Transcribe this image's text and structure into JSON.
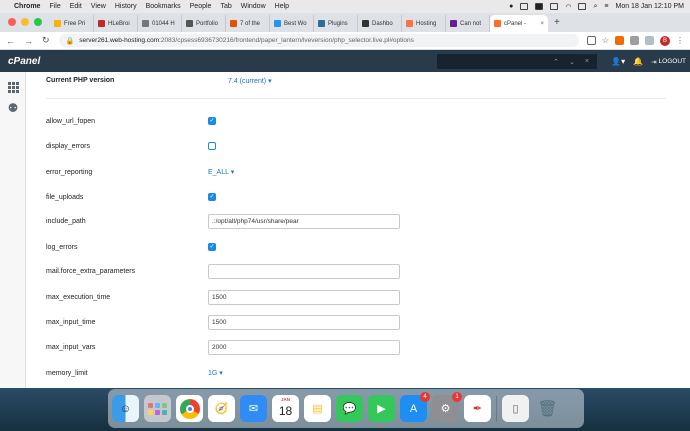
{
  "menubar": {
    "items": [
      "Chrome",
      "File",
      "Edit",
      "View",
      "History",
      "Bookmarks",
      "People",
      "Tab",
      "Window",
      "Help"
    ],
    "clock": "Mon 18 Jan  12:10 PM"
  },
  "tabs": [
    {
      "label": "Free Pri",
      "color": "#f4b400"
    },
    {
      "label": "HLeBroi",
      "color": "#c62828"
    },
    {
      "label": "01044 H",
      "color": "#777777"
    },
    {
      "label": "Portfolio",
      "color": "#555555"
    },
    {
      "label": "7 of the",
      "color": "#e65100"
    },
    {
      "label": "Best Wo",
      "color": "#2196f3"
    },
    {
      "label": "Plugins",
      "color": "#2a6f97"
    },
    {
      "label": "Dashbo",
      "color": "#333333"
    },
    {
      "label": "Hosting",
      "color": "#ff7043"
    },
    {
      "label": "Can not",
      "color": "#6a1b9a"
    },
    {
      "label": "cPanel -",
      "color": "#ff6c2c",
      "active": true
    }
  ],
  "address": {
    "host": "server261.web-hosting.com",
    "path": ":2083/cpsess6936730216/frontend/paper_lantern/lveversion/php_selector.live.pl#options"
  },
  "header": {
    "logo": "cPanel",
    "logout": "LOGOUT",
    "avatar_initial": "B",
    "find_up": "⌃",
    "find_down": "⌄",
    "find_close": "×"
  },
  "php": {
    "current_label": "Current PHP version",
    "current_value": "7.4 (current) ▾"
  },
  "options": [
    {
      "name": "allow_url_fopen",
      "type": "checkbox",
      "checked": true
    },
    {
      "name": "display_errors",
      "type": "checkbox",
      "checked": false
    },
    {
      "name": "error_reporting",
      "type": "dropdown",
      "value": "E_ALL ▾"
    },
    {
      "name": "file_uploads",
      "type": "checkbox",
      "checked": true
    },
    {
      "name": "include_path",
      "type": "text",
      "value": ".:/opt/alt/php74/usr/share/pear"
    },
    {
      "name": "log_errors",
      "type": "checkbox",
      "checked": true
    },
    {
      "name": "mail.force_extra_parameters",
      "type": "text",
      "value": ""
    },
    {
      "name": "max_execution_time",
      "type": "text",
      "value": "1500"
    },
    {
      "name": "max_input_time",
      "type": "text",
      "value": "1500"
    },
    {
      "name": "max_input_vars",
      "type": "text",
      "value": "2000"
    },
    {
      "name": "memory_limit",
      "type": "dropdown",
      "value": "1G ▾"
    }
  ],
  "dock": {
    "calendar_month": "JAN",
    "calendar_day": "18",
    "appstore_badge": "4",
    "settings_badge": "1"
  }
}
